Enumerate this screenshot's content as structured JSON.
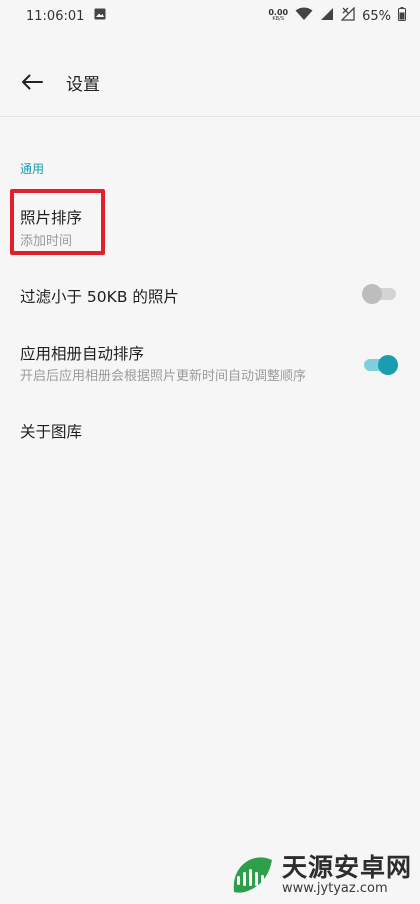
{
  "status_bar": {
    "time": "11:06:01",
    "speed_value": "0.00",
    "speed_unit": "KB/S",
    "battery": "65%"
  },
  "app_bar": {
    "title": "设置"
  },
  "section": {
    "label": "通用"
  },
  "items": [
    {
      "title": "照片排序",
      "subtitle": "添加时间"
    },
    {
      "title": "过滤小于 50KB 的照片",
      "toggle": false
    },
    {
      "title": "应用相册自动排序",
      "subtitle": "开启后应用相册会根据照片更新时间自动调整顺序",
      "toggle": true
    },
    {
      "title": "关于图库"
    }
  ],
  "watermark": {
    "title": "天源安卓网",
    "url": "www.jytyaz.com"
  },
  "colors": {
    "accent": "#1a9db0",
    "highlight": "#e0202a",
    "background": "#f6f6f6"
  }
}
